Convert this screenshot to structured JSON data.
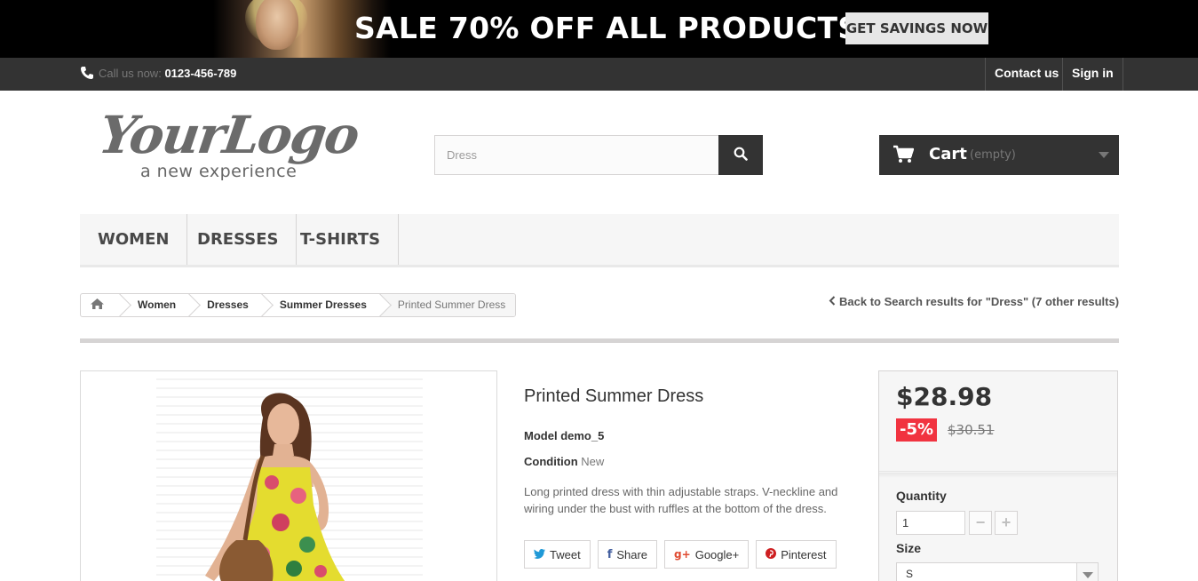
{
  "banner": {
    "title": "SALE 70% OFF ALL PRODUCTS",
    "cta": "GET SAVINGS NOW"
  },
  "topnav": {
    "phone_prefix": "Call us now:",
    "phone_number": "0123-456-789",
    "contact": "Contact us",
    "signin": "Sign in"
  },
  "header": {
    "logo_script": "YourLogo",
    "logo_tagline": "a new experience",
    "search_value": "Dress",
    "cart_label": "Cart",
    "cart_status": "(empty)"
  },
  "menu": {
    "items": [
      {
        "label": "WOMEN"
      },
      {
        "label": "DRESSES"
      },
      {
        "label": "T-SHIRTS"
      }
    ]
  },
  "breadcrumb": {
    "items": [
      "Women",
      "Dresses",
      "Summer Dresses",
      "Printed Summer Dress"
    ]
  },
  "back_link": "Back to Search results for \"Dress\" (7 other results)",
  "product": {
    "title": "Printed Summer Dress",
    "model_label": "Model",
    "model_value": "demo_5",
    "condition_label": "Condition",
    "condition_value": "New",
    "description": "Long printed dress with thin adjustable straps. V-neckline and wiring under the bust with ruffles at the bottom of the dress.",
    "share": [
      "Tweet",
      "Share",
      "Google+",
      "Pinterest"
    ]
  },
  "buybox": {
    "price": "$28.98",
    "discount": "-5%",
    "old_price": "$30.51",
    "quantity_label": "Quantity",
    "quantity_value": "1",
    "size_label": "Size",
    "size_value": "S"
  },
  "colors": {
    "dark": "#333333",
    "discount_red": "#f13340",
    "menu_bg": "#f6f6f6"
  }
}
